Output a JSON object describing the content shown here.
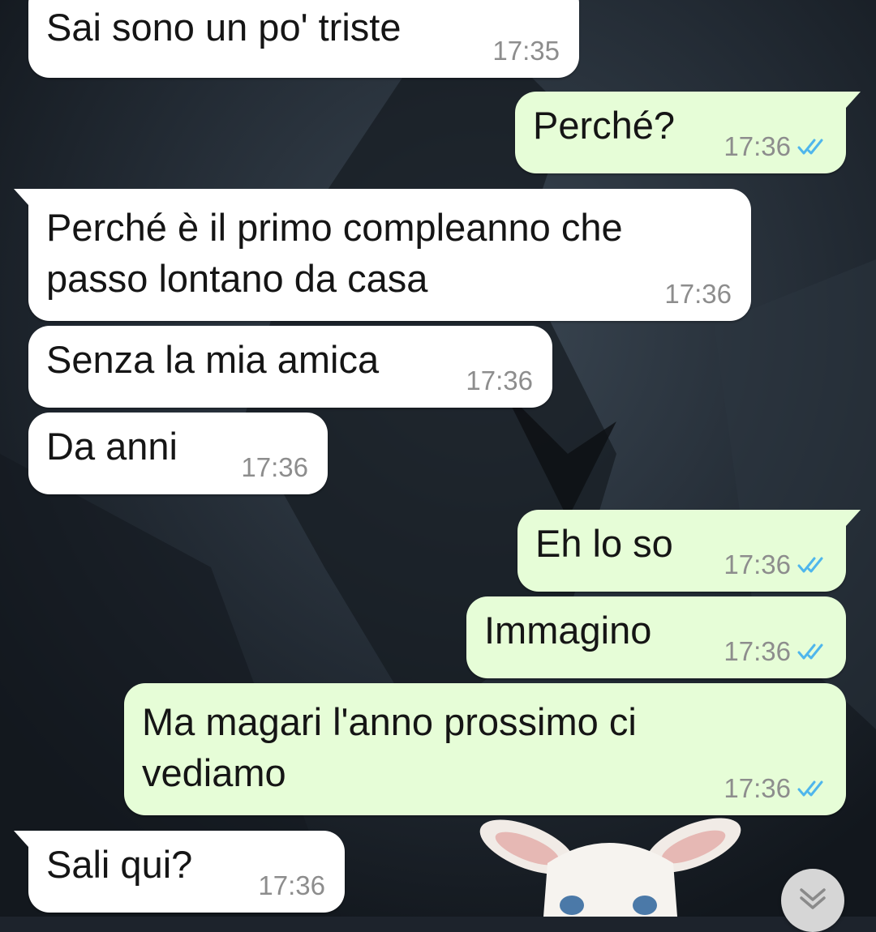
{
  "chat": {
    "messages": [
      {
        "direction": "incoming",
        "text": "Sai sono un po' triste",
        "time": "17:35"
      },
      {
        "direction": "outgoing",
        "text": "Perché?",
        "time": "17:36",
        "status": "read"
      },
      {
        "direction": "incoming",
        "text": "Perché è il primo compleanno che\npasso lontano da casa",
        "time": "17:36"
      },
      {
        "direction": "incoming",
        "text": "Senza la mia amica",
        "time": "17:36"
      },
      {
        "direction": "incoming",
        "text": "Da anni",
        "time": "17:36"
      },
      {
        "direction": "outgoing",
        "text": "Eh lo so",
        "time": "17:36",
        "status": "read"
      },
      {
        "direction": "outgoing",
        "text": "Immagino",
        "time": "17:36",
        "status": "read"
      },
      {
        "direction": "outgoing",
        "text": "Ma magari l'anno prossimo ci\nvediamo",
        "time": "17:36",
        "status": "read"
      },
      {
        "direction": "incoming",
        "text": "Sali qui?",
        "time": "17:36"
      }
    ]
  },
  "controls": {
    "scroll_down_icon": "double-chevron-down-icon"
  },
  "colors": {
    "incoming_bubble": "#ffffff",
    "outgoing_bubble": "#e6fdd7",
    "read_ticks": "#4fb6ec",
    "timestamp": "#8d8d8d"
  }
}
